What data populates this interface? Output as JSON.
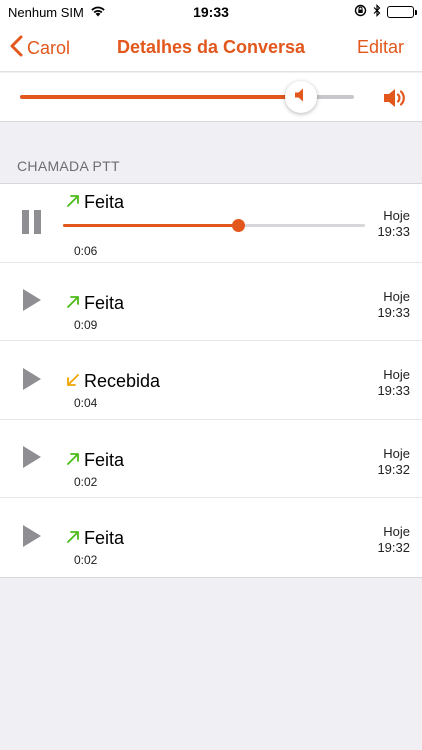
{
  "status_bar": {
    "carrier": "Nenhum SIM",
    "time": "19:33"
  },
  "nav": {
    "back_label": "Carol",
    "title": "Detalhes da Conversa",
    "edit_label": "Editar"
  },
  "volume": {
    "level": 0.84
  },
  "section": {
    "header": "CHAMADA PTT"
  },
  "calls": [
    {
      "state": "playing",
      "direction": "outgoing",
      "label": "Feita",
      "duration": "0:06",
      "day": "Hoje",
      "time": "19:33",
      "progress": 0.58
    },
    {
      "state": "stopped",
      "direction": "outgoing",
      "label": "Feita",
      "duration": "0:09",
      "day": "Hoje",
      "time": "19:33"
    },
    {
      "state": "stopped",
      "direction": "incoming",
      "label": "Recebida",
      "duration": "0:04",
      "day": "Hoje",
      "time": "19:33"
    },
    {
      "state": "stopped",
      "direction": "outgoing",
      "label": "Feita",
      "duration": "0:02",
      "day": "Hoje",
      "time": "19:32"
    },
    {
      "state": "stopped",
      "direction": "outgoing",
      "label": "Feita",
      "duration": "0:02",
      "day": "Hoje",
      "time": "19:32"
    }
  ],
  "colors": {
    "accent": "#e2571c",
    "outgoing": "#4cbb17",
    "incoming": "#f0a500",
    "control": "#8e8e93"
  }
}
